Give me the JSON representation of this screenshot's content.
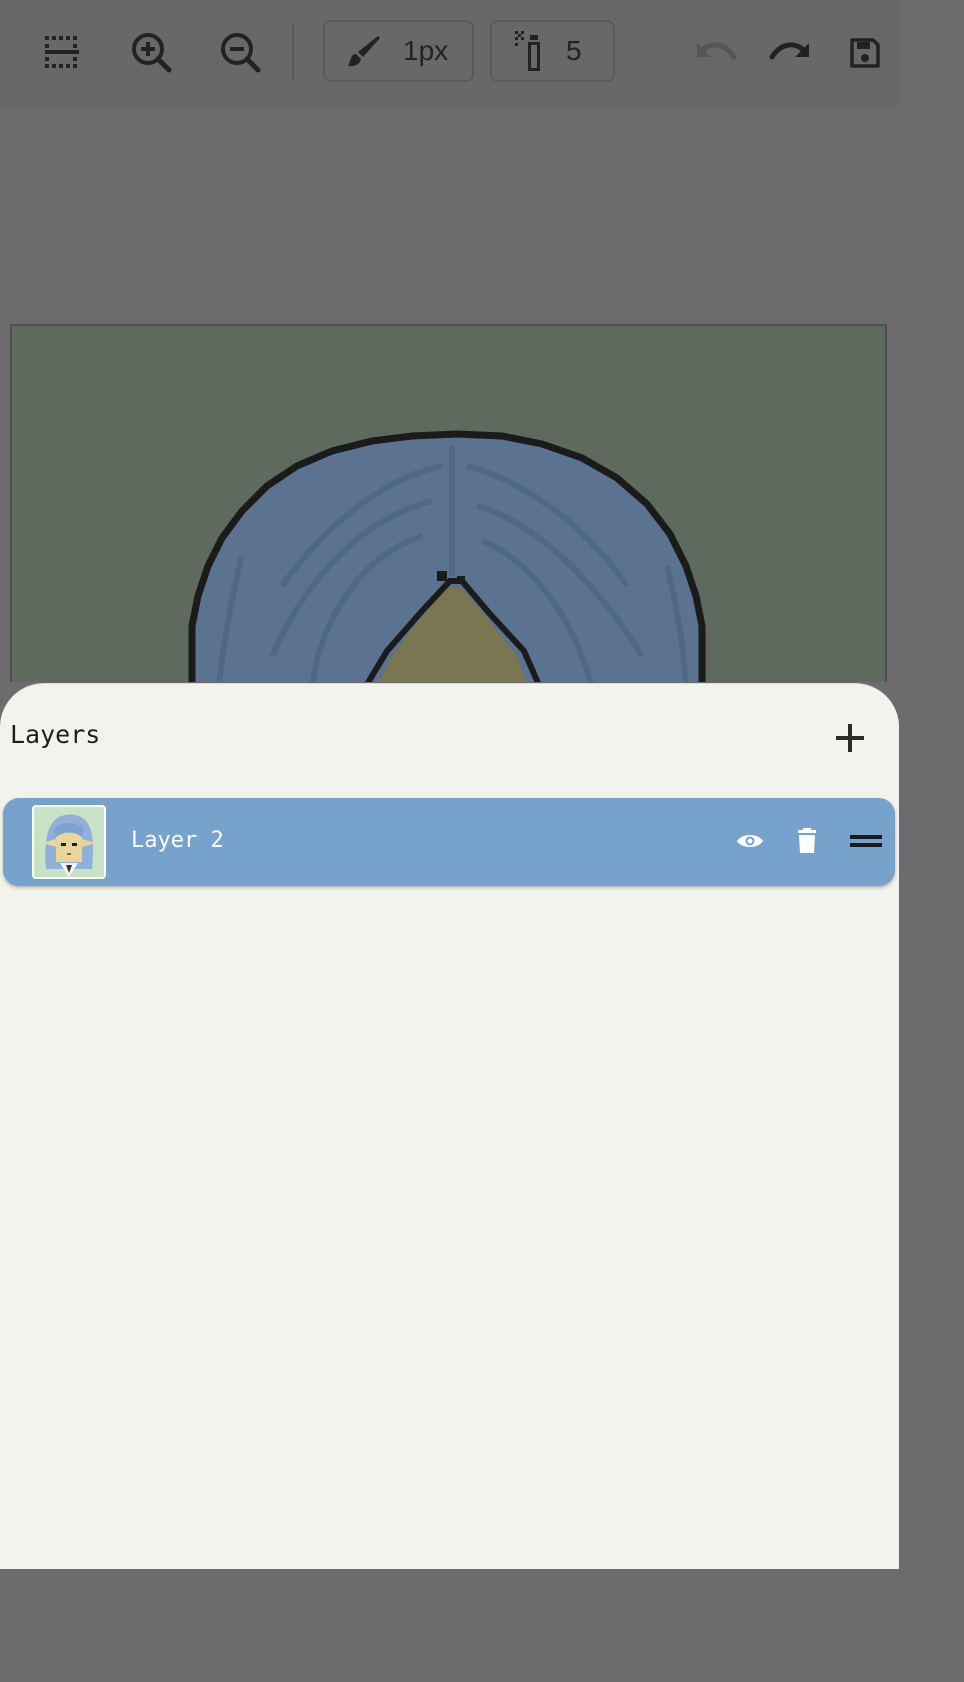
{
  "toolbar": {
    "brush_size_label": "1px",
    "spray_amount_label": "5",
    "icons": [
      "grid-toggle-icon",
      "zoom-in-icon",
      "zoom-out-icon",
      "brush-icon",
      "spray-icon",
      "undo-icon",
      "redo-icon",
      "save-icon"
    ]
  },
  "layers_panel": {
    "title": "Layers",
    "layers": [
      {
        "name": "Layer 2",
        "selected": true,
        "visible": true
      }
    ]
  },
  "colors": {
    "toolbar_bg": "#686868",
    "canvas_bg": "#5d6a5d",
    "sheet_bg": "#f2f3ec",
    "selected_layer_bg": "#76a2cc"
  }
}
